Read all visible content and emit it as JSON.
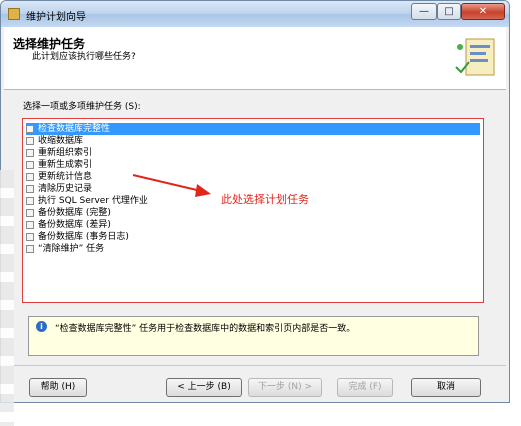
{
  "window": {
    "title": "维护计划向导",
    "controls": {
      "minimize": "—",
      "maximize": "□",
      "close": "✕"
    },
    "app_icon": "maintenance-plan-icon"
  },
  "header": {
    "title": "选择维护任务",
    "subtitle": "此计划应该执行哪些任务?",
    "icon": "wizard-tasks-icon"
  },
  "prompt": "选择一项或多项维护任务 (S):",
  "tasks": [
    {
      "label": "检查数据库完整性",
      "checked": false,
      "selected": true
    },
    {
      "label": "收缩数据库",
      "checked": false,
      "selected": false
    },
    {
      "label": "重新组织索引",
      "checked": false,
      "selected": false
    },
    {
      "label": "重新生成索引",
      "checked": false,
      "selected": false
    },
    {
      "label": "更新统计信息",
      "checked": false,
      "selected": false
    },
    {
      "label": "清除历史记录",
      "checked": false,
      "selected": false
    },
    {
      "label": "执行 SQL Server 代理作业",
      "checked": false,
      "selected": false
    },
    {
      "label": "备份数据库 (完整)",
      "checked": false,
      "selected": false
    },
    {
      "label": "备份数据库 (差异)",
      "checked": false,
      "selected": false
    },
    {
      "label": "备份数据库 (事务日志)",
      "checked": false,
      "selected": false
    },
    {
      "label": "“清除维护” 任务",
      "checked": false,
      "selected": false
    }
  ],
  "annotation": "此处选择计划任务",
  "annotation_color": "#e1261c",
  "description": "“检查数据库完整性” 任务用于检查数据库中的数据和索引页内部是否一致。",
  "buttons": {
    "help": "帮助 (H)",
    "back": "< 上一步 (B)",
    "next": "下一步 (N) >",
    "finish": "完成 (F)",
    "cancel": "取消"
  }
}
